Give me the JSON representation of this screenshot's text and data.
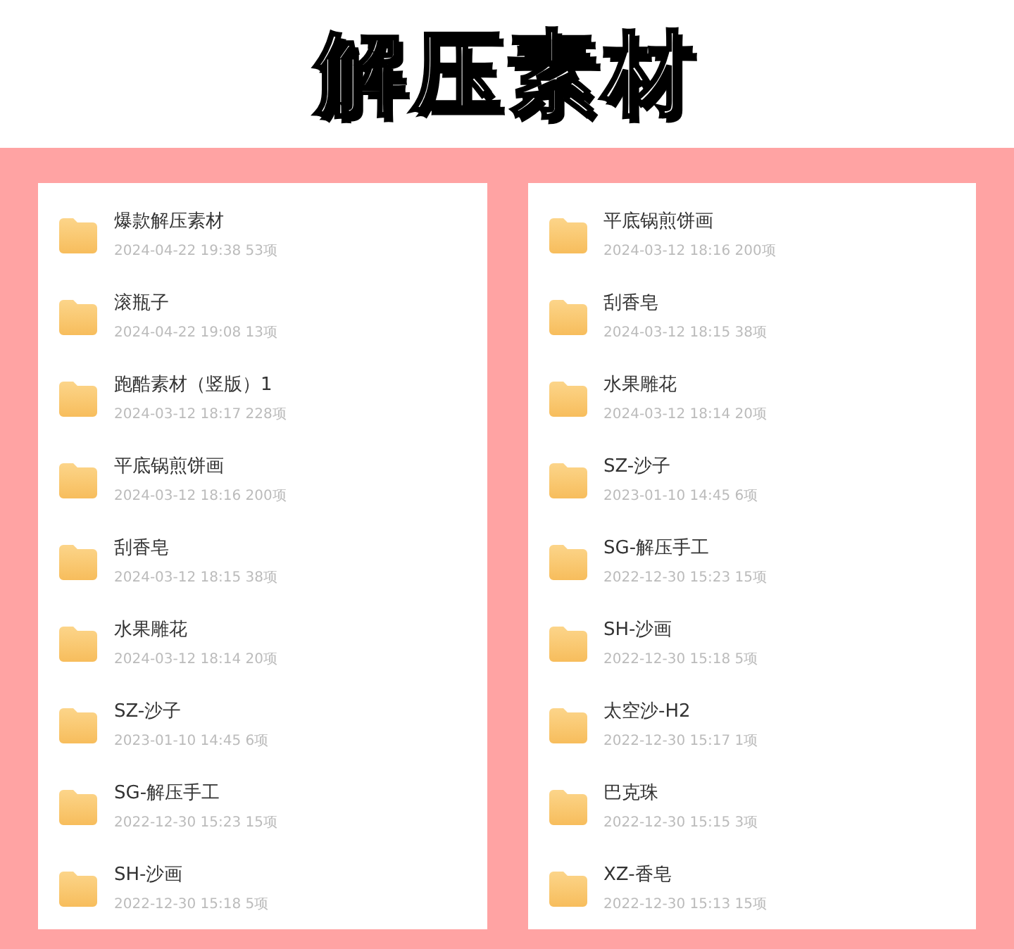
{
  "title": "解压素材",
  "panels": [
    {
      "folders": [
        {
          "name": "爆款解压素材",
          "meta": "2024-04-22 19:38 53项"
        },
        {
          "name": "滚瓶子",
          "meta": "2024-04-22 19:08 13项"
        },
        {
          "name": "跑酷素材（竖版）1",
          "meta": "2024-03-12 18:17 228项"
        },
        {
          "name": "平底锅煎饼画",
          "meta": "2024-03-12 18:16 200项"
        },
        {
          "name": "刮香皂",
          "meta": "2024-03-12 18:15 38项"
        },
        {
          "name": "水果雕花",
          "meta": "2024-03-12 18:14 20项"
        },
        {
          "name": "SZ-沙子",
          "meta": "2023-01-10 14:45 6项"
        },
        {
          "name": "SG-解压手工",
          "meta": "2022-12-30 15:23 15项"
        },
        {
          "name": "SH-沙画",
          "meta": "2022-12-30 15:18 5项"
        }
      ]
    },
    {
      "folders": [
        {
          "name": "平底锅煎饼画",
          "meta": "2024-03-12 18:16 200项"
        },
        {
          "name": "刮香皂",
          "meta": "2024-03-12 18:15 38项"
        },
        {
          "name": "水果雕花",
          "meta": "2024-03-12 18:14 20项"
        },
        {
          "name": "SZ-沙子",
          "meta": "2023-01-10 14:45 6项"
        },
        {
          "name": "SG-解压手工",
          "meta": "2022-12-30 15:23 15项"
        },
        {
          "name": "SH-沙画",
          "meta": "2022-12-30 15:18 5项"
        },
        {
          "name": "太空沙-H2",
          "meta": "2022-12-30 15:17 1项"
        },
        {
          "name": "巴克珠",
          "meta": "2022-12-30 15:15 3项"
        },
        {
          "name": "XZ-香皂",
          "meta": "2022-12-30 15:13 15项"
        }
      ]
    }
  ]
}
